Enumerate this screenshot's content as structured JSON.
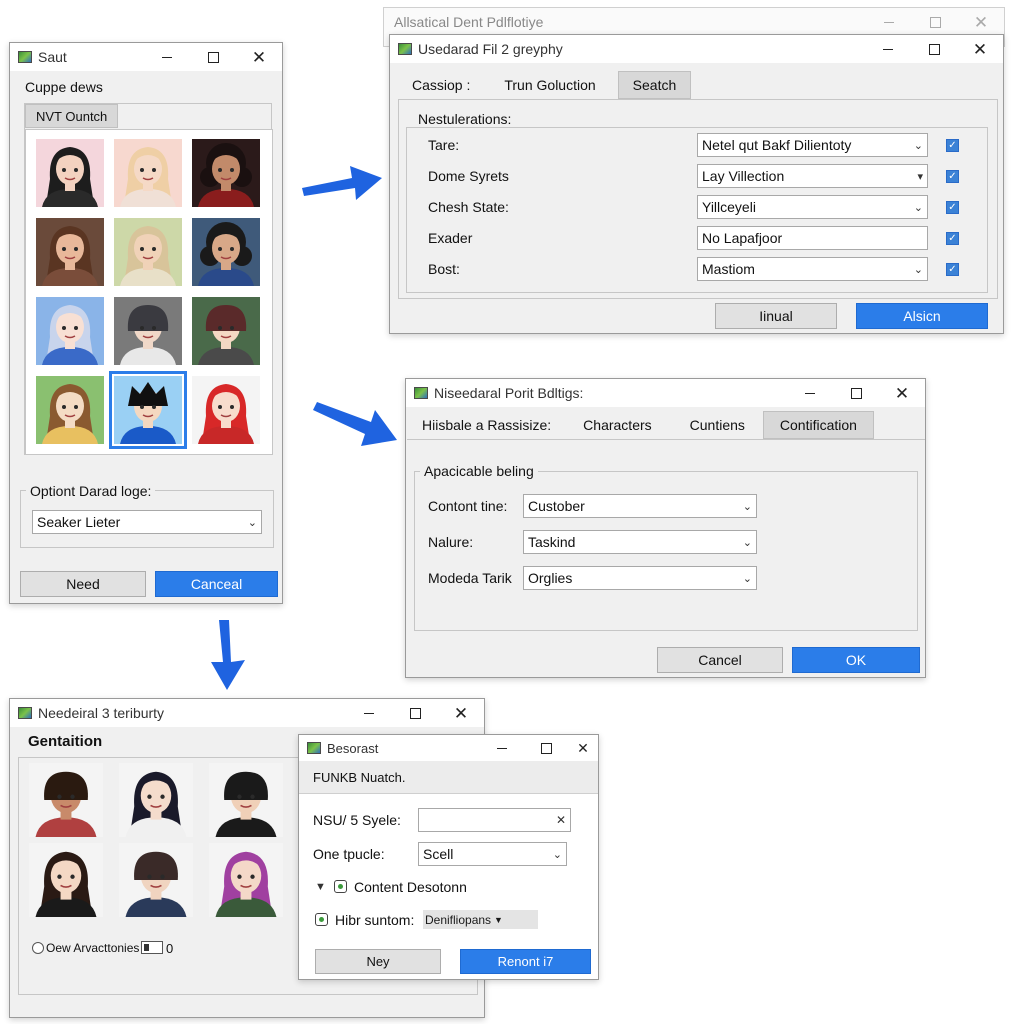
{
  "win1": {
    "title": "Saut",
    "heading": "Cuppe dews",
    "tab": "NVT Ountch",
    "group_label": "Optiont Darad loge:",
    "select_value": "Seaker Lieter",
    "btn_left": "Need",
    "btn_right": "Canceal"
  },
  "win2": {
    "bg_title": "Allsatical Dent Pdlflotiye",
    "title": "Usedarad Fil 2 greyphy",
    "tabs": [
      "Cassiop :",
      "Trun Goluction",
      "Seatch"
    ],
    "group_label": "Nestulerations:",
    "rows": [
      {
        "label": "Tare:",
        "value": "Netel qut Bakf Dilientoty"
      },
      {
        "label": "Dome Syrets",
        "value": "Lay Villection"
      },
      {
        "label": "Chesh State:",
        "value": "Yillceyeli"
      },
      {
        "label": "Exader",
        "value": "No Lapafjoor"
      },
      {
        "label": "Bost:",
        "value": "Mastiom"
      }
    ],
    "btn_left": "Iinual",
    "btn_right": "Alsicn"
  },
  "win3": {
    "title": "Niseedaral Porit Bdltigs:",
    "tabs": [
      "Hiisbale a Rassisize:",
      "Characters",
      "Cuntiens",
      "Contification"
    ],
    "group_label": "Apacicable beling",
    "rows": [
      {
        "label": "Contont tine:",
        "value": "Custober"
      },
      {
        "label": "Nalure:",
        "value": "Taskind"
      },
      {
        "label": "Modeda Tarik",
        "value": "Orglies"
      }
    ],
    "btn_left": "Cancel",
    "btn_right": "OK"
  },
  "win4": {
    "title": "Needeiral 3 teriburty",
    "heading": "Gentaition",
    "option_label": "Oew Arvacttonies",
    "option_count": "0"
  },
  "win5": {
    "title": "Besorast",
    "header": "FUNKB Nuatch.",
    "row1_label": "NSU/ 5 Syele:",
    "row1_value": "",
    "row2_label": "One tpucle:",
    "row2_value": "Scell",
    "check1": "Content Desotonn",
    "check2_label": "Hibr suntom:",
    "check2_value": "Denifliopans",
    "btn_left": "Ney",
    "btn_right": "Renont i7"
  },
  "colors": {
    "accent": "#2b7de9",
    "arrow": "#1f63e0"
  }
}
